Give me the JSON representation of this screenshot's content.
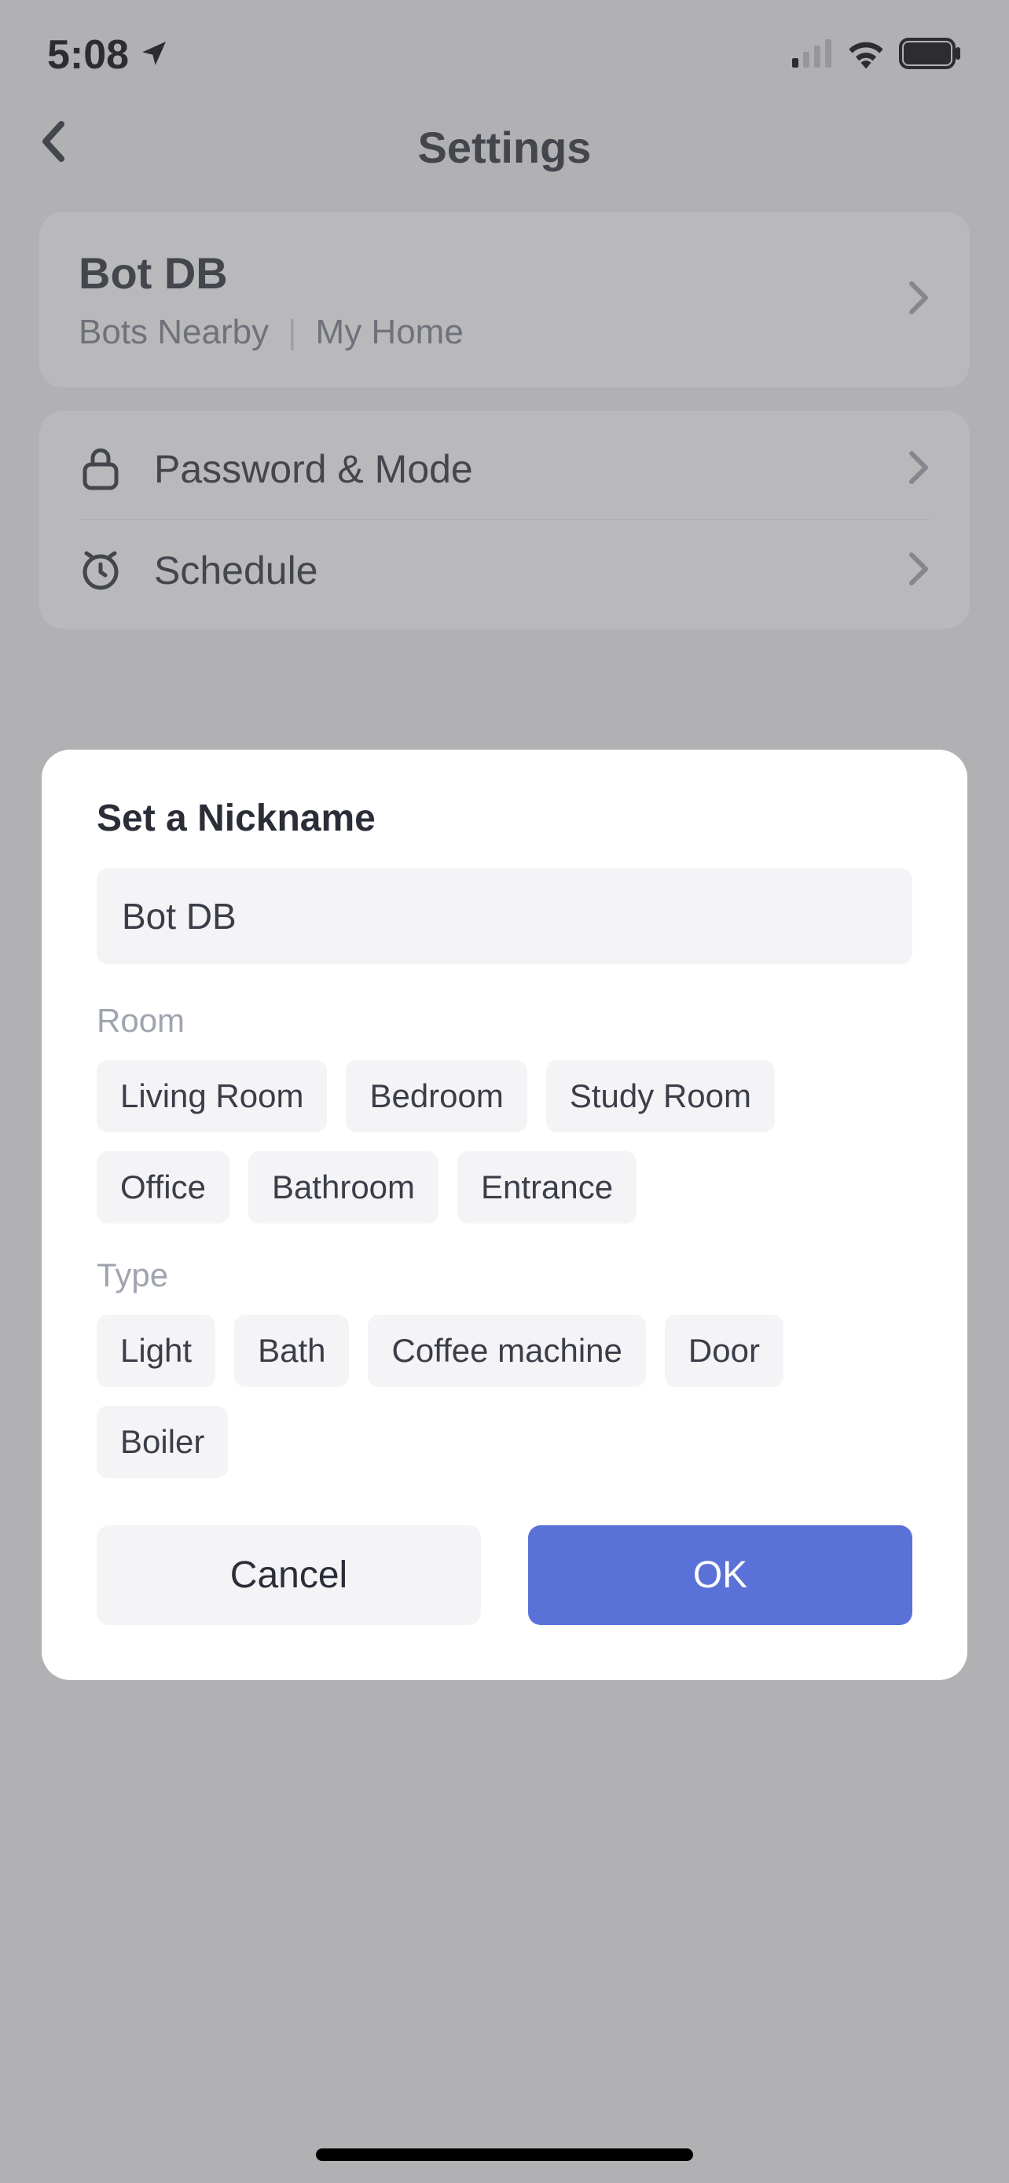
{
  "status_bar": {
    "time": "5:08"
  },
  "nav": {
    "title": "Settings"
  },
  "device_card": {
    "name": "Bot DB",
    "sub1": "Bots Nearby",
    "sub2": "My Home"
  },
  "menu": {
    "item1": "Password & Mode",
    "item2": "Schedule"
  },
  "modal": {
    "title": "Set a Nickname",
    "input_value": "Bot DB",
    "room_label": "Room",
    "rooms": {
      "r0": "Living Room",
      "r1": "Bedroom",
      "r2": "Study Room",
      "r3": "Office",
      "r4": "Bathroom",
      "r5": "Entrance"
    },
    "type_label": "Type",
    "types": {
      "t0": "Light",
      "t1": "Bath",
      "t2": "Coffee machine",
      "t3": "Door",
      "t4": "Boiler"
    },
    "cancel": "Cancel",
    "ok": "OK"
  }
}
